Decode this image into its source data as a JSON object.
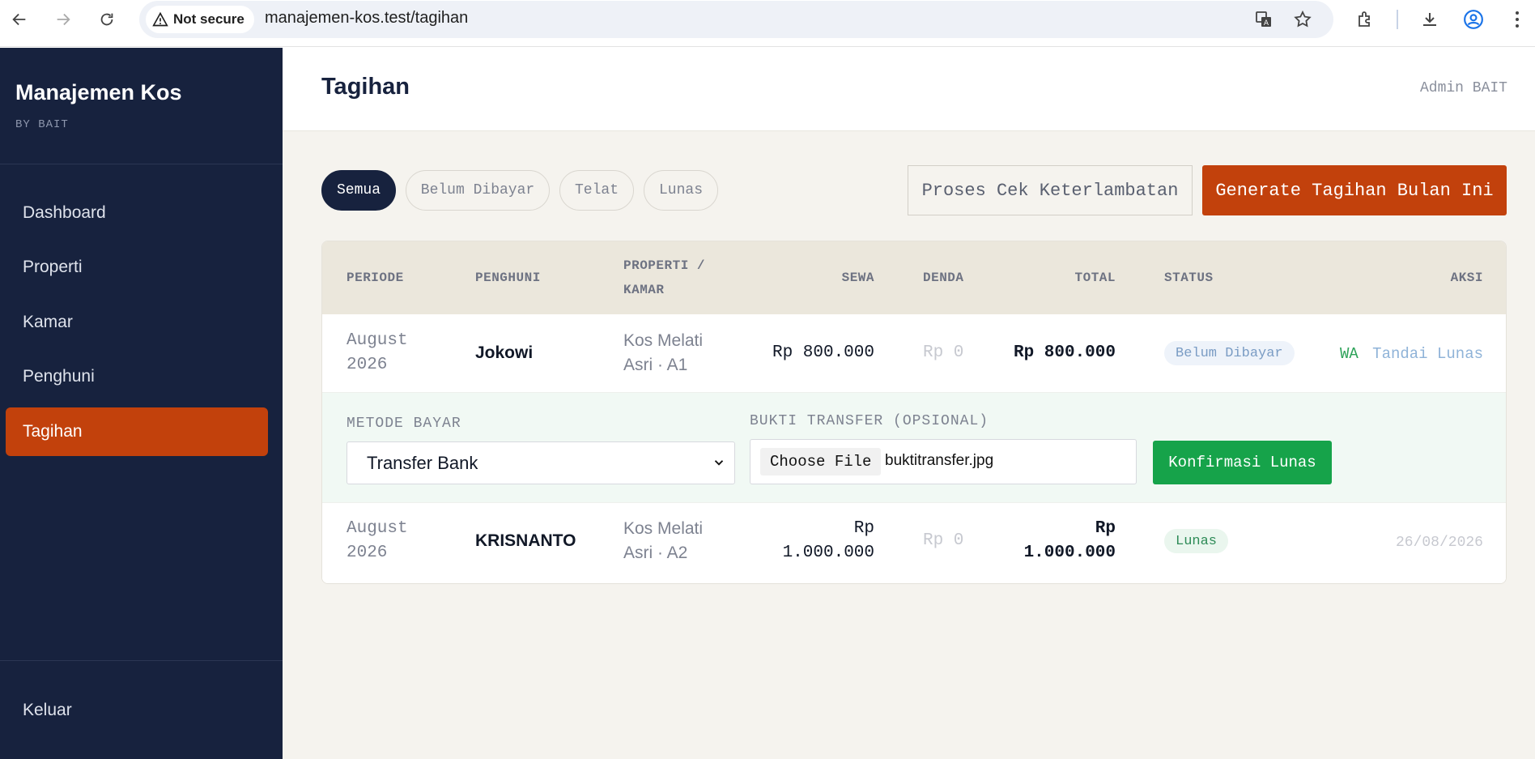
{
  "browser": {
    "security_label": "Not secure",
    "url": "manajemen-kos.test/tagihan"
  },
  "sidebar": {
    "brand": "Manajemen Kos",
    "brand_sub": "BY BAIT",
    "items": [
      {
        "label": "Dashboard"
      },
      {
        "label": "Properti"
      },
      {
        "label": "Kamar"
      },
      {
        "label": "Penghuni"
      },
      {
        "label": "Tagihan"
      }
    ],
    "logout": "Keluar"
  },
  "header": {
    "title": "Tagihan",
    "user": "Admin BAIT"
  },
  "filters": [
    {
      "label": "Semua",
      "active": true
    },
    {
      "label": "Belum Dibayar"
    },
    {
      "label": "Telat"
    },
    {
      "label": "Lunas"
    }
  ],
  "actions": {
    "check_late": "Proses Cek Keterlambatan",
    "generate": "Generate Tagihan Bulan Ini"
  },
  "table": {
    "headers": {
      "periode": "PERIODE",
      "penghuni": "PENGHUNI",
      "properti_1": "PROPERTI /",
      "properti_2": "KAMAR",
      "sewa": "SEWA",
      "denda": "DENDA",
      "total": "TOTAL",
      "status": "STATUS",
      "aksi": "AKSI"
    },
    "rows": [
      {
        "periode_1": "August",
        "periode_2": "2026",
        "penghuni": "Jokowi",
        "properti_1": "Kos Melati",
        "properti_2": "Asri · A1",
        "sewa": "Rp 800.000",
        "denda": "Rp 0",
        "total": "Rp 800.000",
        "status": "Belum Dibayar",
        "wa": "WA",
        "mark_paid": "Tandai Lunas"
      },
      {
        "periode_1": "August",
        "periode_2": "2026",
        "penghuni": "KRISNANTO",
        "properti_1": "Kos Melati",
        "properti_2": "Asri · A2",
        "sewa_1": "Rp",
        "sewa_2": "1.000.000",
        "denda": "Rp 0",
        "total_1": "Rp",
        "total_2": "1.000.000",
        "status": "Lunas",
        "paid_date": "26/08/2026"
      }
    ]
  },
  "payment_form": {
    "method_label": "METODE BAYAR",
    "method_value": "Transfer Bank",
    "proof_label": "BUKTI TRANSFER (OPSIONAL)",
    "choose_file": "Choose File",
    "file_name": "buktitransfer.jpg",
    "confirm": "Konfirmasi Lunas"
  }
}
